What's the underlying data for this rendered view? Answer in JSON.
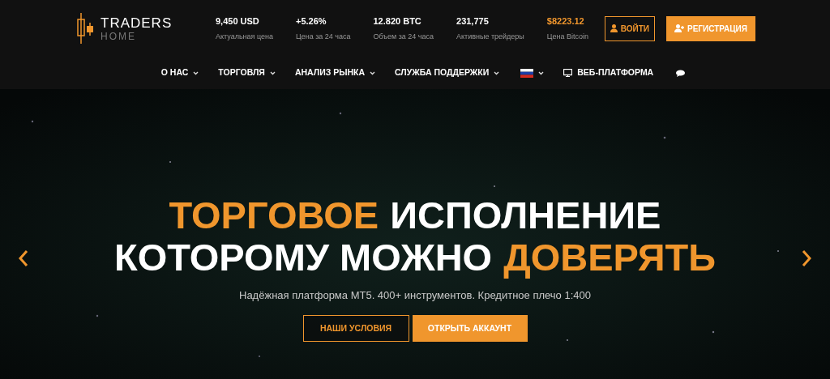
{
  "logo": {
    "name": "TRADERS",
    "tagline": "HOME"
  },
  "stats": [
    {
      "value": "9,450 USD",
      "label": "Актуальная цена",
      "highlight": false
    },
    {
      "value": "+5.26%",
      "label": "Цена за 24 часа",
      "highlight": false
    },
    {
      "value": "12.820 BTC",
      "label": "Объем за 24 часа",
      "highlight": false
    },
    {
      "value": "231,775",
      "label": "Активные трейдеры",
      "highlight": false
    },
    {
      "value": "$8223.12",
      "label": "Цена Bitcoin",
      "highlight": true
    }
  ],
  "auth_buttons": [
    {
      "label": "ВОЙТИ",
      "kind": "outline"
    },
    {
      "label": "РЕГИСТРАЦИЯ",
      "kind": "filled"
    }
  ],
  "nav": [
    {
      "kind": "menu",
      "label": "О НАС",
      "dropdown": true
    },
    {
      "kind": "menu",
      "label": "ТОРГОВЛЯ",
      "dropdown": true
    },
    {
      "kind": "menu",
      "label": "АНАЛИЗ РЫНКА",
      "dropdown": true
    },
    {
      "kind": "menu",
      "label": "СЛУЖБА ПОДДЕРЖКИ",
      "dropdown": true
    },
    {
      "kind": "flag",
      "dropdown": true
    },
    {
      "kind": "platform",
      "label": "ВЕБ-ПЛАТФОРМА",
      "dropdown": false
    },
    {
      "kind": "chat",
      "dropdown": false
    }
  ],
  "hero": {
    "headline": [
      [
        {
          "text": "ТОРГОВОЕ",
          "accent": true
        },
        {
          "text": "ИСПОЛНЕНИЕ",
          "accent": false
        }
      ],
      [
        {
          "text": "КОТОРОМУ МОЖНО",
          "accent": false
        },
        {
          "text": "ДОВЕРЯТЬ",
          "accent": true
        }
      ]
    ],
    "subtitle": "Надёжная платформа MT5. 400+ инструментов. Кредитное плечо 1:400",
    "buttons": [
      {
        "label": "НАШИ УСЛОВИЯ",
        "kind": "outline"
      },
      {
        "label": "ОТКРЫТЬ АККАУНТ",
        "kind": "filled"
      }
    ]
  }
}
